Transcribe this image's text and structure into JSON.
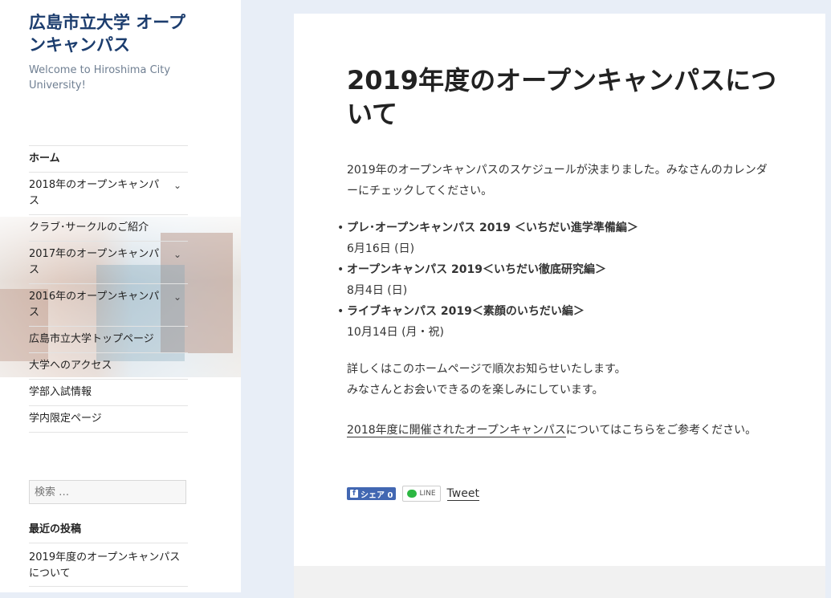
{
  "site": {
    "title": "広島市立大学 オープンキャンパス",
    "description": "Welcome to Hiroshima City University!"
  },
  "nav": {
    "items": [
      {
        "label": "ホーム",
        "has_submenu": false,
        "active": true
      },
      {
        "label": "2018年のオープンキャンパス",
        "has_submenu": true
      },
      {
        "label": "クラブ･サークルのご紹介",
        "has_submenu": false
      },
      {
        "label": "2017年のオープンキャンパス",
        "has_submenu": true
      },
      {
        "label": "2016年のオープンキャンパス",
        "has_submenu": true
      },
      {
        "label": "広島市立大学トップページ",
        "has_submenu": false
      },
      {
        "label": "大学へのアクセス",
        "has_submenu": false
      },
      {
        "label": "学部入試情報",
        "has_submenu": false
      },
      {
        "label": "学内限定ページ",
        "has_submenu": false
      }
    ],
    "chevron": "⌄"
  },
  "search": {
    "placeholder": "検索 …"
  },
  "recent_posts": {
    "heading": "最近の投稿",
    "items": [
      "2019年度のオープンキャンパスについて"
    ]
  },
  "article": {
    "title": "2019年度のオープンキャンパスについて",
    "intro": "2019年のオープンキャンパスのスケジュールが決まりました。みなさんのカレンダーにチェックしてください。",
    "events": [
      {
        "title": "プレ･オープンキャンパス 2019 ＜いちだい進学準備編＞",
        "date": "6月16日 (日)"
      },
      {
        "title": "オープンキャンパス 2019＜いちだい徹底研究編＞",
        "date": "8月4日 (日)"
      },
      {
        "title": "ライブキャンパス 2019＜素顔のいちだい編＞",
        "date": "10月14日 (月・祝)"
      }
    ],
    "bullet": "•",
    "notice_line1": "詳しくはこのホームページで順次お知らせいたします。",
    "notice_line2": "みなさんとお会いできるのを楽しみにしています。",
    "link_text": "2018年度に開催されたオープンキャンパス",
    "link_suffix": "についてはこちらをご参考ください。"
  },
  "share": {
    "facebook_label": "シェア 0",
    "facebook_icon": "f",
    "line_label": "LINE",
    "tweet_label": "Tweet"
  },
  "colors": {
    "accent": "#1c3d6e",
    "background": "#e8eef7",
    "facebook": "#4267b2",
    "line": "#2cb742"
  }
}
